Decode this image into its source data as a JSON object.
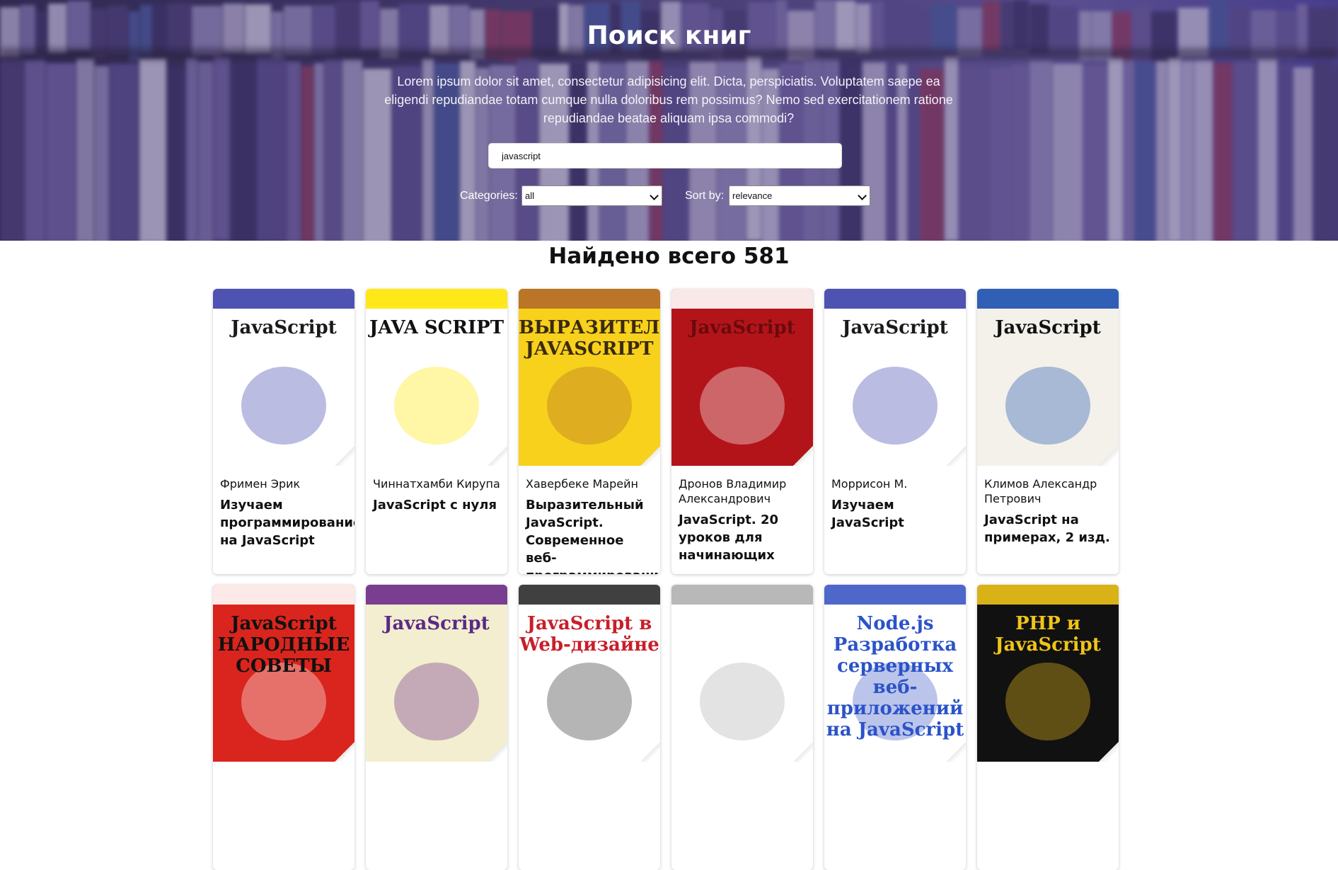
{
  "hero": {
    "title": "Поиск книг",
    "description": "Lorem ipsum dolor sit amet, consectetur adipisicing elit. Dicta, perspiciatis. Voluptatem saepe ea eligendi repudiandae totam cumque nulla doloribus rem possimus? Nemo sed exercitationem ratione repudiandae beatae aliquam ipsa commodi?",
    "search_value": "javascript",
    "categories_label": "Categories:",
    "categories_value": "all",
    "sort_label": "Sort by:",
    "sort_value": "relevance"
  },
  "results": {
    "title": "Найдено всего 581"
  },
  "books": [
    {
      "author": "Фримен Эрик",
      "title": "Изучаем программирование на JavaScript",
      "cover_bg": "#ffffff",
      "cover_accent": "#3b3fa8",
      "cover_text": "JavaScript",
      "cover_text_color": "#1a1a1a"
    },
    {
      "author": "Чиннатхамби Кирупа",
      "title": "JavaScript с нуля",
      "cover_bg": "#ffffff",
      "cover_accent": "#ffe600",
      "cover_text": "JAVA SCRIPT",
      "cover_text_color": "#111111"
    },
    {
      "author": "Хавербеке Марейн",
      "title": "Выразительный JavaScript. Современное веб-программирование.",
      "cover_bg": "#f7d11c",
      "cover_accent": "#b36a28",
      "cover_text": "ВЫРАЗИТЕЛЬНЫЙ JAVASCRIPT",
      "cover_text_color": "#3a2a10"
    },
    {
      "author": "Дронов Владимир Александрович",
      "title": "JavaScript. 20 уроков для начинающих",
      "cover_bg": "#b3141a",
      "cover_accent": "#ffffff",
      "cover_text": "JavaScript",
      "cover_text_color": "#6a0a0d"
    },
    {
      "author": "Моррисон М.",
      "title": "Изучаем JavaScript",
      "cover_bg": "#ffffff",
      "cover_accent": "#3b3fa8",
      "cover_text": "JavaScript",
      "cover_text_color": "#1a1a1a"
    },
    {
      "author": "Климов Александр Петрович",
      "title": "JavaScript на примерах, 2 изд.",
      "cover_bg": "#f3f1ea",
      "cover_accent": "#1d4fb0",
      "cover_text": "JavaScript",
      "cover_text_color": "#111111"
    },
    {
      "author": "",
      "title": "",
      "cover_bg": "#d9251d",
      "cover_accent": "#ffffff",
      "cover_text": "JavaScript НАРОДНЫЕ СОВЕТЫ",
      "cover_text_color": "#111111"
    },
    {
      "author": "",
      "title": "",
      "cover_bg": "#f3eecf",
      "cover_accent": "#6d2a8a",
      "cover_text": "JavaScript",
      "cover_text_color": "#5a2a85"
    },
    {
      "author": "",
      "title": "",
      "cover_bg": "#ffffff",
      "cover_accent": "#2b2b2b",
      "cover_text": "JavaScript в Web-дизайне",
      "cover_text_color": "#c81e2a"
    },
    {
      "author": "",
      "title": "",
      "cover_bg": "#ffffff",
      "cover_accent": "#b0b0b0",
      "cover_text": "",
      "cover_text_color": "#777777"
    },
    {
      "author": "",
      "title": "",
      "cover_bg": "#ffffff",
      "cover_accent": "#3b57c4",
      "cover_text": "Node.js Разработка серверных веб-приложений на JavaScript",
      "cover_text_color": "#2b53c8"
    },
    {
      "author": "",
      "title": "",
      "cover_bg": "#111111",
      "cover_accent": "#f0c419",
      "cover_text": "PHP и JavaScript",
      "cover_text_color": "#f0c419"
    }
  ]
}
